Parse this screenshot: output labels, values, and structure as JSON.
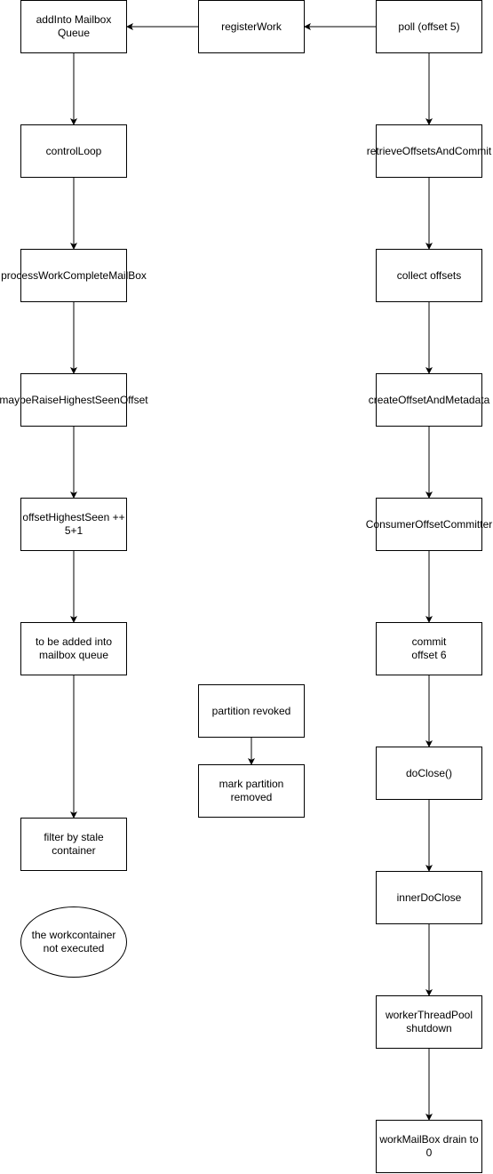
{
  "diagram": {
    "nodes": [
      {
        "id": "addIntoMailboxQueue",
        "label": "addInto Mailbox\nQueue"
      },
      {
        "id": "registerWork",
        "label": "registerWork"
      },
      {
        "id": "poll",
        "label": "poll (offset 5)"
      },
      {
        "id": "controlLoop",
        "label": "controlLoop"
      },
      {
        "id": "retrieveOffsetsAndCommit",
        "label": "retrieveOffsetsAndCommit"
      },
      {
        "id": "processWorkCompleteMailBox",
        "label": "processWorkCompleteMailBox"
      },
      {
        "id": "collectOffsets",
        "label": "collect offsets"
      },
      {
        "id": "maybeRaiseHighestSeenOffset",
        "label": "maybeRaiseHighestSeenOffset"
      },
      {
        "id": "createOffsetAndMetadata",
        "label": "createOffsetAndMetadata"
      },
      {
        "id": "offsetHighestSeen",
        "label": "offsetHighestSeen ++\n5+1"
      },
      {
        "id": "consumerOffsetCommitter",
        "label": "ConsumerOffsetCommitter"
      },
      {
        "id": "toBeAdded",
        "label": "to be added into\nmailbox queue"
      },
      {
        "id": "commitOffset6",
        "label": "commit\noffset 6"
      },
      {
        "id": "partitionRevoked",
        "label": "partition revoked"
      },
      {
        "id": "markPartitionRemoved",
        "label": "mark partition\nremoved"
      },
      {
        "id": "doClose",
        "label": "doClose()"
      },
      {
        "id": "filterByStale",
        "label": "filter by stale\ncontainer"
      },
      {
        "id": "innerDoClose",
        "label": "innerDoClose"
      },
      {
        "id": "workContainerNotExecuted",
        "label": "the workcontainer\nnot executed"
      },
      {
        "id": "workerThreadPoolShutdown",
        "label": "workerThreadPool\nshutdown"
      },
      {
        "id": "workMailBoxDrain",
        "label": "workMailBox drain to\n0"
      }
    ],
    "edges": [
      {
        "from": "poll",
        "to": "registerWork"
      },
      {
        "from": "registerWork",
        "to": "addIntoMailboxQueue"
      },
      {
        "from": "addIntoMailboxQueue",
        "to": "controlLoop"
      },
      {
        "from": "controlLoop",
        "to": "processWorkCompleteMailBox"
      },
      {
        "from": "processWorkCompleteMailBox",
        "to": "maybeRaiseHighestSeenOffset"
      },
      {
        "from": "maybeRaiseHighestSeenOffset",
        "to": "offsetHighestSeen"
      },
      {
        "from": "offsetHighestSeen",
        "to": "toBeAdded"
      },
      {
        "from": "toBeAdded",
        "to": "filterByStale"
      },
      {
        "from": "partitionRevoked",
        "to": "markPartitionRemoved"
      },
      {
        "from": "poll",
        "to": "retrieveOffsetsAndCommit"
      },
      {
        "from": "retrieveOffsetsAndCommit",
        "to": "collectOffsets"
      },
      {
        "from": "collectOffsets",
        "to": "createOffsetAndMetadata"
      },
      {
        "from": "createOffsetAndMetadata",
        "to": "consumerOffsetCommitter"
      },
      {
        "from": "consumerOffsetCommitter",
        "to": "commitOffset6"
      },
      {
        "from": "commitOffset6",
        "to": "doClose"
      },
      {
        "from": "doClose",
        "to": "innerDoClose"
      },
      {
        "from": "innerDoClose",
        "to": "workerThreadPoolShutdown"
      },
      {
        "from": "workerThreadPoolShutdown",
        "to": "workMailBoxDrain"
      }
    ]
  }
}
